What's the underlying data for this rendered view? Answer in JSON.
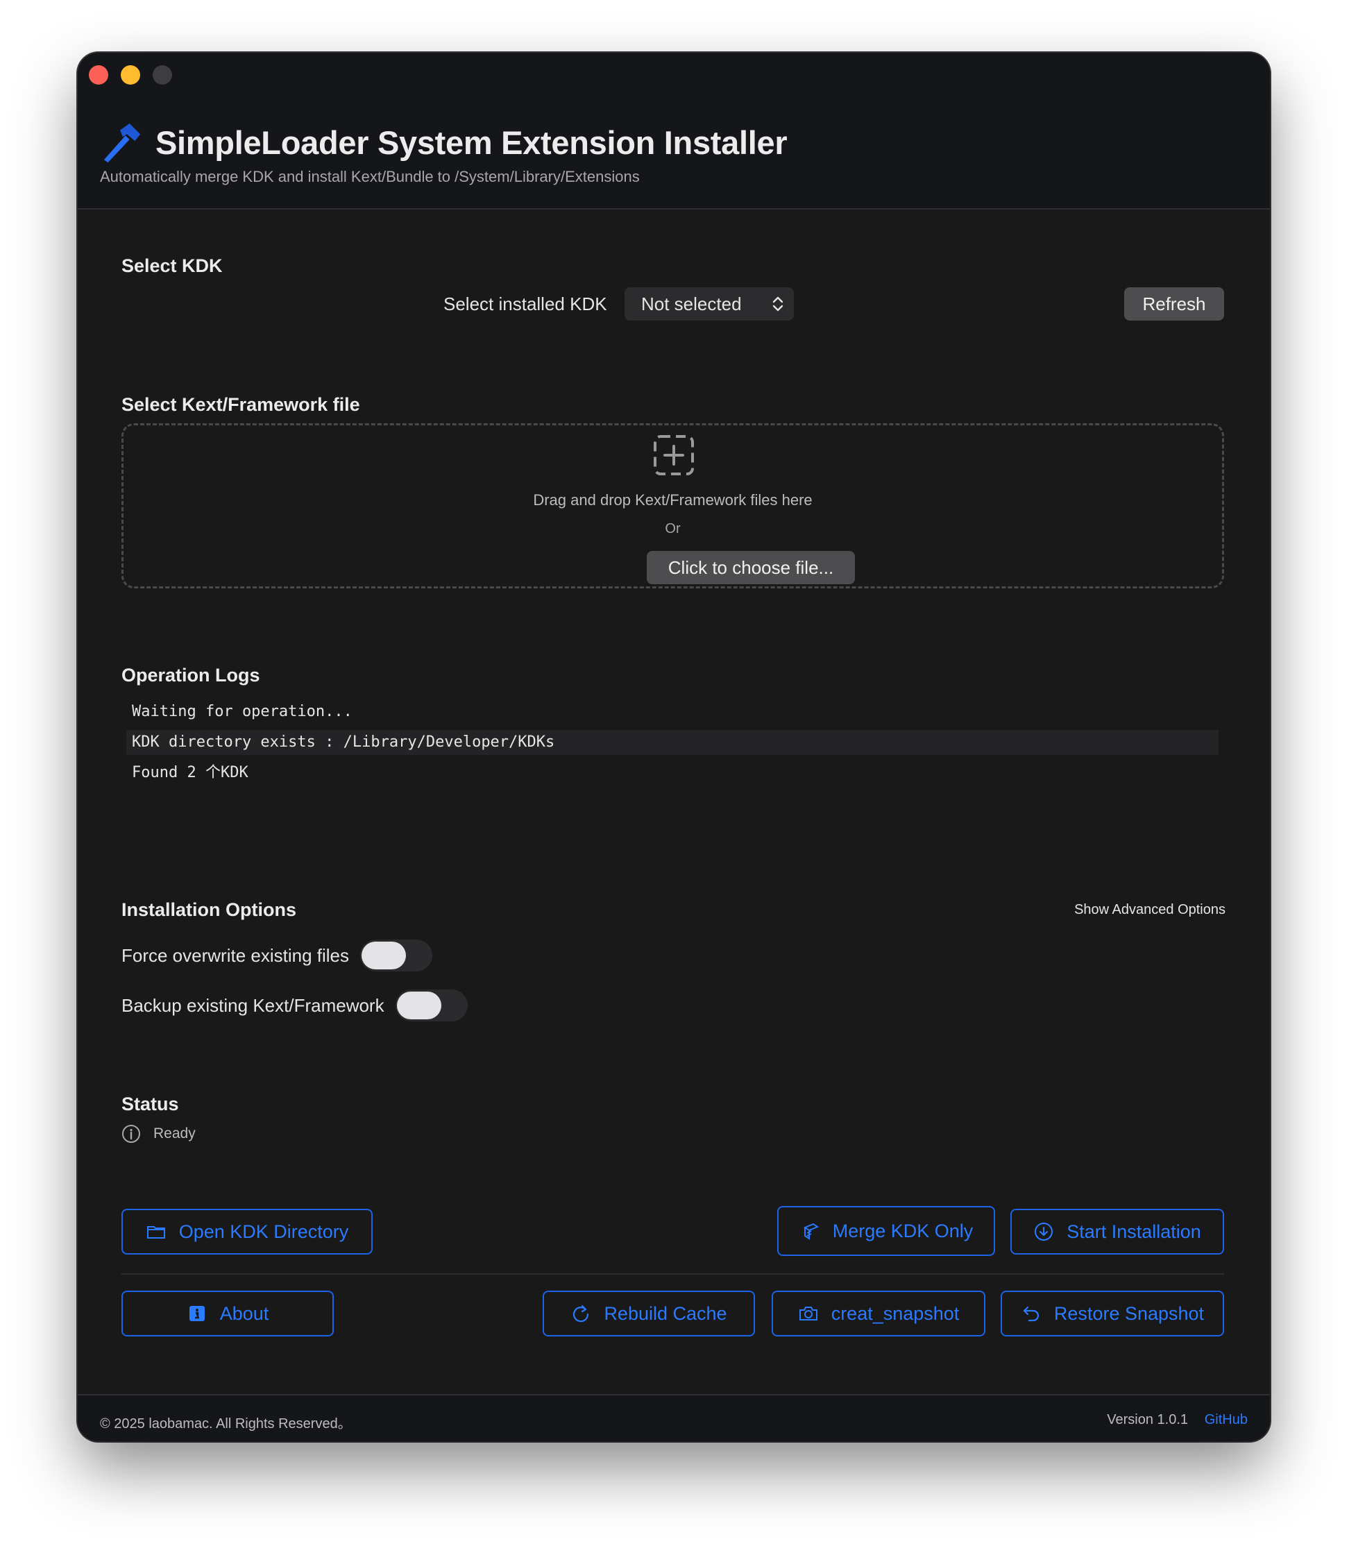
{
  "header": {
    "title": "SimpleLoader System Extension Installer",
    "subtitle": "Automatically merge KDK and install Kext/Bundle to /System/Library/Extensions"
  },
  "kdk": {
    "section_title": "Select KDK",
    "select_label": "Select installed KDK",
    "selected_value": "Not selected",
    "refresh_label": "Refresh"
  },
  "file": {
    "section_title": "Select Kext/Framework file",
    "drop_text": "Drag and drop Kext/Framework files here",
    "or_text": "Or",
    "choose_label": "Click to choose file..."
  },
  "logs": {
    "section_title": "Operation Logs",
    "lines": [
      "Waiting for operation...",
      "KDK directory exists : /Library/Developer/KDKs",
      "Found 2 个KDK"
    ]
  },
  "options": {
    "section_title": "Installation Options",
    "advanced_label": "Show Advanced Options",
    "items": [
      {
        "label": "Force overwrite existing files"
      },
      {
        "label": "Backup existing Kext/Framework"
      }
    ]
  },
  "status": {
    "section_title": "Status",
    "text": "Ready"
  },
  "actions": {
    "open_kdk_dir": "Open KDK Directory",
    "merge_kdk_only": "Merge KDK Only",
    "start_installation": "Start Installation",
    "about": "About",
    "rebuild_cache": "Rebuild Cache",
    "create_snapshot": "creat_snapshot",
    "restore_snapshot": "Restore Snapshot"
  },
  "footer": {
    "copyright": "© 2025 laobamac. All Rights Reserved。",
    "version": "Version 1.0.1",
    "github": "GitHub"
  },
  "colors": {
    "accent": "#1c63e8",
    "window_bg": "#19191a",
    "header_bg": "#151619"
  }
}
